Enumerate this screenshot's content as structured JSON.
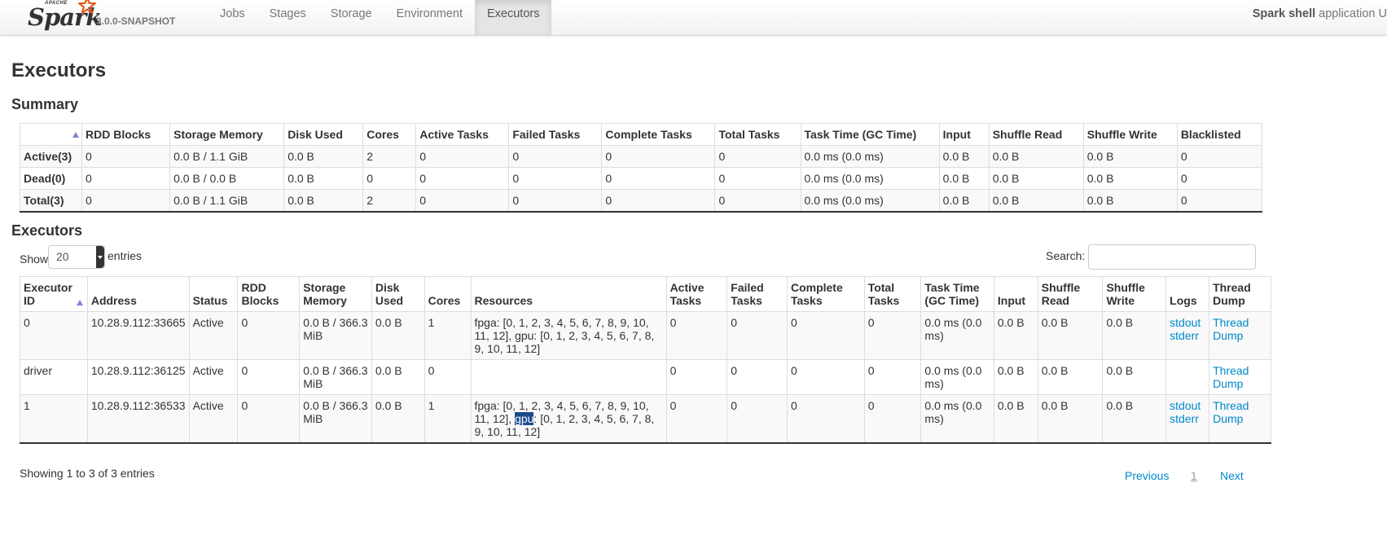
{
  "navbar": {
    "apache": "APACHE",
    "brand": "Spark",
    "version": "3.0.0-SNAPSHOT",
    "tabs": [
      "Jobs",
      "Stages",
      "Storage",
      "Environment",
      "Executors"
    ],
    "active_tab": "Executors",
    "app_name_bold": "Spark shell",
    "app_name_rest": " application U"
  },
  "page_title": "Executors",
  "summary": {
    "heading": "Summary",
    "headers": [
      "",
      "RDD Blocks",
      "Storage Memory",
      "Disk Used",
      "Cores",
      "Active Tasks",
      "Failed Tasks",
      "Complete Tasks",
      "Total Tasks",
      "Task Time (GC Time)",
      "Input",
      "Shuffle Read",
      "Shuffle Write",
      "Blacklisted"
    ],
    "rows": [
      [
        "Active(3)",
        "0",
        "0.0 B / 1.1 GiB",
        "0.0 B",
        "2",
        "0",
        "0",
        "0",
        "0",
        "0.0 ms (0.0 ms)",
        "0.0 B",
        "0.0 B",
        "0.0 B",
        "0"
      ],
      [
        "Dead(0)",
        "0",
        "0.0 B / 0.0 B",
        "0.0 B",
        "0",
        "0",
        "0",
        "0",
        "0",
        "0.0 ms (0.0 ms)",
        "0.0 B",
        "0.0 B",
        "0.0 B",
        "0"
      ],
      [
        "Total(3)",
        "0",
        "0.0 B / 1.1 GiB",
        "0.0 B",
        "2",
        "0",
        "0",
        "0",
        "0",
        "0.0 ms (0.0 ms)",
        "0.0 B",
        "0.0 B",
        "0.0 B",
        "0"
      ]
    ]
  },
  "executors": {
    "heading": "Executors",
    "show_label": "Show",
    "page_size": "20",
    "entries_label": "entries",
    "search_label": "Search:",
    "search_value": "",
    "headers": [
      "Executor ID",
      "Address",
      "Status",
      "RDD Blocks",
      "Storage Memory",
      "Disk Used",
      "Cores",
      "Resources",
      "Active Tasks",
      "Failed Tasks",
      "Complete Tasks",
      "Total Tasks",
      "Task Time (GC Time)",
      "Input",
      "Shuffle Read",
      "Shuffle Write",
      "Logs",
      "Thread Dump"
    ],
    "rows": [
      {
        "id": "0",
        "address": "10.28.9.112:33665",
        "status": "Active",
        "rdd": "0",
        "storage": "0.0 B / 366.3 MiB",
        "disk": "0.0 B",
        "cores": "1",
        "res_fpga_label": "fpga",
        "res_fpga": ": [0, 1, 2, 3, 4, 5, 6, 7, 8, 9, 10, 11, 12], ",
        "res_gpu_label": "gpu",
        "res_gpu": ": [0, 1, 2, 3, 4, 5, 6, 7, 8, 9, 10, 11, 12]",
        "active": "0",
        "failed": "0",
        "complete": "0",
        "total": "0",
        "task_time": "0.0 ms (0.0 ms)",
        "input": "0.0 B",
        "shuffle_read": "0.0 B",
        "shuffle_write": "0.0 B",
        "stdout": "stdout",
        "stderr": "stderr",
        "thread_dump": "Thread Dump"
      },
      {
        "id": "driver",
        "address": "10.28.9.112:36125",
        "status": "Active",
        "rdd": "0",
        "storage": "0.0 B / 366.3 MiB",
        "disk": "0.0 B",
        "cores": "0",
        "active": "0",
        "failed": "0",
        "complete": "0",
        "total": "0",
        "task_time": "0.0 ms (0.0 ms)",
        "input": "0.0 B",
        "shuffle_read": "0.0 B",
        "shuffle_write": "0.0 B",
        "thread_dump": "Thread Dump"
      },
      {
        "id": "1",
        "address": "10.28.9.112:36533",
        "status": "Active",
        "rdd": "0",
        "storage": "0.0 B / 366.3 MiB",
        "disk": "0.0 B",
        "cores": "1",
        "res_fpga_label": "fpga",
        "res_fpga": ": [0, 1, 2, 3, 4, 5, 6, 7, 8, 9, 10, 11, 12], ",
        "res_gpu_label": "gpu",
        "res_gpu": ": [0, 1, 2, 3, 4, 5, 6, 7, 8, 9, 10, 11, 12]",
        "active": "0",
        "failed": "0",
        "complete": "0",
        "total": "0",
        "task_time": "0.0 ms (0.0 ms)",
        "input": "0.0 B",
        "shuffle_read": "0.0 B",
        "shuffle_write": "0.0 B",
        "stdout": "stdout",
        "stderr": "stderr",
        "thread_dump": "Thread Dump"
      }
    ],
    "info": "Showing 1 to 3 of 3 entries",
    "pager": {
      "previous": "Previous",
      "page": "1",
      "next": "Next"
    }
  },
  "colors": {
    "link": "#0088cc",
    "sort_arrow": "#7a85d8",
    "selection": "#1a4b8c"
  }
}
